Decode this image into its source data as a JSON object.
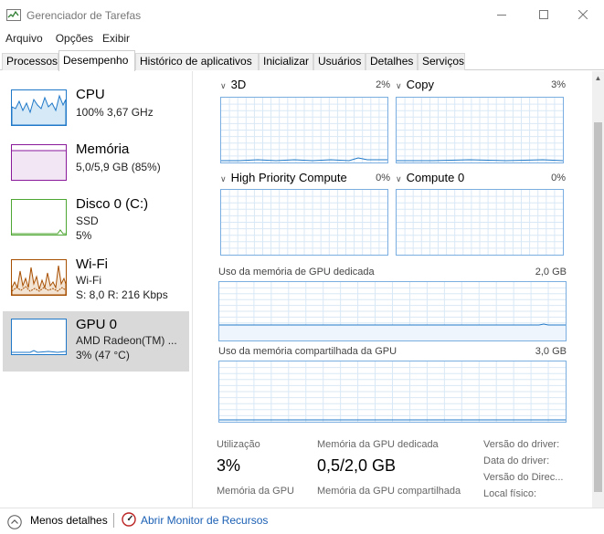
{
  "window": {
    "title": "Gerenciador de Tarefas"
  },
  "menu": [
    "Arquivo",
    "Opções",
    "Exibir"
  ],
  "tabs": [
    {
      "label": "Processos"
    },
    {
      "label": "Desempenho"
    },
    {
      "label": "Histórico de aplicativos"
    },
    {
      "label": "Inicializar"
    },
    {
      "label": "Usuários"
    },
    {
      "label": "Detalhes"
    },
    {
      "label": "Serviços"
    }
  ],
  "sidebar": {
    "items": [
      {
        "title": "CPU",
        "line1": "100% 3,67 GHz",
        "line2": "",
        "line3": "",
        "color": "#1f78c8"
      },
      {
        "title": "Memória",
        "line1": "5,0/5,9 GB (85%)",
        "line2": "",
        "line3": "",
        "color": "#8b1a9b"
      },
      {
        "title": "Disco 0 (C:)",
        "line1": "SSD",
        "line2": "5%",
        "line3": "",
        "color": "#4da632"
      },
      {
        "title": "Wi-Fi",
        "line1": "Wi-Fi",
        "line2": "S: 8,0 R: 216 Kbps",
        "line3": "",
        "color": "#a74f01"
      },
      {
        "title": "GPU 0",
        "line1": "AMD Radeon(TM) ...",
        "line2": "3% (47 °C)",
        "line3": "",
        "color": "#1f78c8"
      }
    ]
  },
  "graphs": [
    {
      "name": "3D",
      "pct": "2%"
    },
    {
      "name": "Copy",
      "pct": "3%"
    },
    {
      "name": "High Priority Compute",
      "pct": "0%"
    },
    {
      "name": "Compute 0",
      "pct": "0%"
    }
  ],
  "memory_graphs": [
    {
      "label": "Uso da memória de GPU dedicada",
      "max": "2,0 GB"
    },
    {
      "label": "Uso da memória compartilhada da GPU",
      "max": "3,0 GB"
    }
  ],
  "stats": {
    "utilization_label": "Utilização",
    "utilization_value": "3%",
    "dedicated_label": "Memória da GPU dedicada",
    "dedicated_value": "0,5/2,0 GB",
    "gpu_memory_label": "Memória da GPU",
    "shared_label": "Memória da GPU compartilhada",
    "driver_version": "Versão do driver:",
    "driver_date": "Data do driver:",
    "directx_version": "Versão do Direc...",
    "physical_location": "Local físico:"
  },
  "footer": {
    "fewer_details": "Menos detalhes",
    "open_monitor": "Abrir Monitor de Recursos"
  },
  "colors": {
    "graph_border": "#7aaee0",
    "grid": "#d9e8f6",
    "link": "#1a5fb4",
    "selected": "#d9d9d9"
  }
}
